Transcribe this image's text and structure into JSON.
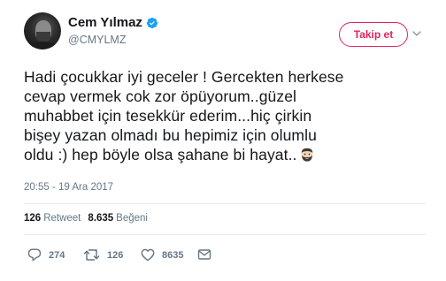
{
  "user": {
    "display_name": "Cem Yılmaz",
    "handle": "@CMYLMZ",
    "verified": true
  },
  "follow_button": {
    "label": "Takip et",
    "color": "#e0245e"
  },
  "tweet": {
    "lines": [
      "Hadi çocukkar iyi geceler !  Gercekten herkese",
      "cevap vermek cok zor öpüyorum..güzel",
      "muhabbet için tesekkür ederim...hiç çirkin",
      "bişey yazan olmadı bu hepimiz için olumlu",
      "oldu :) hep böyle olsa şahane bi hayat.."
    ],
    "trailing_emoji": "man-with-beard-emoji",
    "timestamp": "20:55 - 19 Ara 2017"
  },
  "stats": {
    "retweets_count": "126",
    "retweets_label": "Retweet",
    "likes_count": "8.635",
    "likes_label": "Beğeni"
  },
  "actions": {
    "reply_count": "274",
    "retweet_count": "126",
    "like_count": "8635",
    "icons": [
      "reply-icon",
      "retweet-icon",
      "like-icon",
      "direct-message-icon"
    ]
  },
  "colors": {
    "text_primary": "#14171a",
    "text_secondary": "#657786",
    "verified": "#1da1f2",
    "divider": "#e6ecf0"
  }
}
